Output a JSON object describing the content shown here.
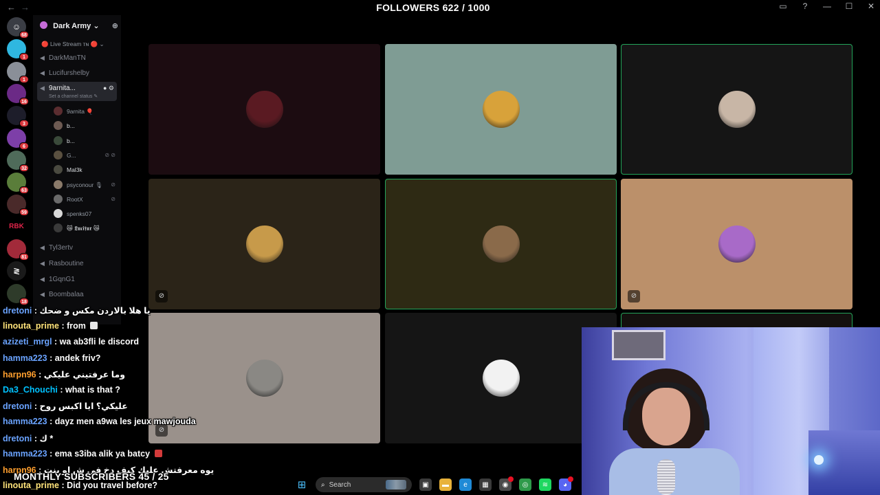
{
  "overlay": {
    "followers": "FOLLOWERS 622 / 1000",
    "subscribers": "MONTHLY SUBSCRIBERS 45 / 25"
  },
  "window": {
    "back_glyph": "←",
    "forward_glyph": "→",
    "controls": [
      "▭",
      "?",
      "—",
      "☐",
      "✕"
    ]
  },
  "rail": {
    "servers": [
      {
        "badge": "68",
        "color": "#3a3d44",
        "glyph": "☺"
      },
      {
        "badge": "1",
        "color": "#2fb7e0",
        "glyph": ""
      },
      {
        "badge": "1",
        "color": "#8a8f98",
        "glyph": ""
      },
      {
        "badge": "16",
        "color": "#6b2a86",
        "glyph": ""
      },
      {
        "badge": "3",
        "color": "#1d1d2a",
        "glyph": ""
      },
      {
        "badge": "6",
        "color": "#7d3fa8",
        "glyph": ""
      },
      {
        "badge": "32",
        "color": "#4f6b5a",
        "glyph": ""
      },
      {
        "badge": "63",
        "color": "#5a7d3a",
        "glyph": ""
      },
      {
        "badge": "59",
        "color": "#4a2a2a",
        "glyph": ""
      },
      {
        "badge": "",
        "color": "#000000",
        "glyph": "RBK"
      },
      {
        "badge": "81",
        "color": "#a22a3a",
        "glyph": ""
      },
      {
        "badge": "",
        "color": "#1a1a1a",
        "glyph": "≷"
      },
      {
        "badge": "18",
        "color": "#2e3b2a",
        "glyph": ""
      }
    ]
  },
  "sidebar": {
    "guild_name": "Dark Army",
    "guild_chevron": "⌄",
    "invite_icon": "⊕",
    "category": "🔴 Live Stream ᴛɴ 🔴 ⌄",
    "channels_top": [
      "DarkManTN",
      "Lucifurshelby"
    ],
    "active_channel": {
      "name": "9arnita...",
      "controls": "● ⚙",
      "status": "Set a channel status ✎"
    },
    "members": [
      {
        "name": "9arnita 🎈",
        "color": "#5b2d30",
        "flags": "",
        "bold": false
      },
      {
        "name": "b...",
        "color": "#6d5a52",
        "flags": "",
        "bold": true
      },
      {
        "name": "b...",
        "color": "#3a4a3a",
        "flags": "",
        "bold": true
      },
      {
        "name": "G...",
        "color": "#5a5040",
        "flags": "⊘ ⊘",
        "bold": false
      },
      {
        "name": "Mal3k",
        "color": "#4a4a40",
        "flags": "",
        "bold": true
      },
      {
        "name": "psyconour 🎙",
        "color": "#8a7a6a",
        "flags": "⊘",
        "bold": false
      },
      {
        "name": "RootX",
        "color": "#6a6a6a",
        "flags": "⊘",
        "bold": false
      },
      {
        "name": "spenks07",
        "color": "#d8d8d8",
        "flags": "",
        "bold": false
      },
      {
        "name": "😿 𝕷𝖚𝖈𝖎𝖋𝖚𝖗 😿",
        "color": "#3a3a3a",
        "flags": "",
        "bold": true
      }
    ],
    "channels_bottom": [
      "Tyl3ertv",
      "Rasboutine",
      "1GqnG1",
      "Boombalaa"
    ]
  },
  "grid": {
    "tiles": [
      {
        "bg": "#1c0c11",
        "avatar": "#5a1a22",
        "speaking": false,
        "muted": false
      },
      {
        "bg": "#7f9c94",
        "avatar": "#d8a23a",
        "speaking": false,
        "muted": false
      },
      {
        "bg": "#151515",
        "avatar": "#c8b6a6",
        "speaking": true,
        "muted": false
      },
      {
        "bg": "#2b2418",
        "avatar": "#c79a4a",
        "speaking": false,
        "muted": true
      },
      {
        "bg": "#2e2a14",
        "avatar": "#8a6a4a",
        "speaking": true,
        "muted": false
      },
      {
        "bg": "#bb906a",
        "avatar": "#a86ac8",
        "speaking": false,
        "muted": true
      },
      {
        "bg": "#9a918b",
        "avatar": "#8a8884",
        "speaking": false,
        "muted": true
      },
      {
        "bg": "#151515",
        "avatar": "#f2f2f2",
        "speaking": false,
        "muted": false
      },
      {
        "bg": "#14100e",
        "avatar": "",
        "speaking": true,
        "muted": false
      }
    ],
    "mute_glyph": "⊘"
  },
  "chat": {
    "messages": [
      {
        "user": "dretoni",
        "color": "#6aa3ff",
        "text": " : يا هلا بالاردن مكس و ضحك",
        "emote": ""
      },
      {
        "user": "linouta_prime",
        "color": "#ffe37a",
        "text": " : from ",
        "emote": "#e8e8e8"
      },
      {
        "user": "azizeti_mrgl",
        "color": "#6aa3ff",
        "text": " : wa ab3fli le discord",
        "emote": ""
      },
      {
        "user": "hamma223",
        "color": "#6aa3ff",
        "text": " : andek friv?",
        "emote": ""
      },
      {
        "user": "harpn96",
        "color": "#ff9f2e",
        "text": " : وما عرفتيني عليكي",
        "emote": ""
      },
      {
        "user": "Da3_Chouchi",
        "color": "#00c2ff",
        "text": " : what is that ?",
        "emote": ""
      },
      {
        "user": "dretoni",
        "color": "#6aa3ff",
        "text": " : عليكي؟ ايا اكبس روح",
        "emote": ""
      },
      {
        "user": "hamma223",
        "color": "#6aa3ff",
        "text": " : dayz men a9wa les jeux mawjouda",
        "emote": ""
      },
      {
        "user": "dretoni",
        "color": "#6aa3ff",
        "text": " : ك *",
        "emote": ""
      },
      {
        "user": "hamma223",
        "color": "#6aa3ff",
        "text": " : ema s3iba alik ya batcy ",
        "emote": "#d33a3a"
      },
      {
        "user": "harpn96",
        "color": "#ff9f2e",
        "text": " : يوه معرفتش عليك كيف دخ في ش او بنت",
        "emote": ""
      },
      {
        "user": "linouta_prime",
        "color": "#ffe37a",
        "text": " : Did you travel before?",
        "emote": ""
      }
    ]
  },
  "taskbar": {
    "start_glyph": "⊞",
    "search_placeholder": "Search",
    "search_glyph": "⌕",
    "apps": [
      {
        "name": "task-view",
        "color": "#3a3a3a",
        "glyph": "▣"
      },
      {
        "name": "file-explorer",
        "color": "#e8b23a",
        "glyph": "▬"
      },
      {
        "name": "edge",
        "color": "#1f8ad6",
        "glyph": "e"
      },
      {
        "name": "store",
        "color": "#3a3a3a",
        "glyph": "▦"
      },
      {
        "name": "app-extra",
        "color": "#4a4a4a",
        "glyph": "◉"
      },
      {
        "name": "chrome",
        "color": "#2f9a4a",
        "glyph": "◎"
      },
      {
        "name": "spotify",
        "color": "#1ed760",
        "glyph": "≋"
      },
      {
        "name": "discord",
        "color": "#5865f2",
        "glyph": "◕"
      }
    ]
  }
}
